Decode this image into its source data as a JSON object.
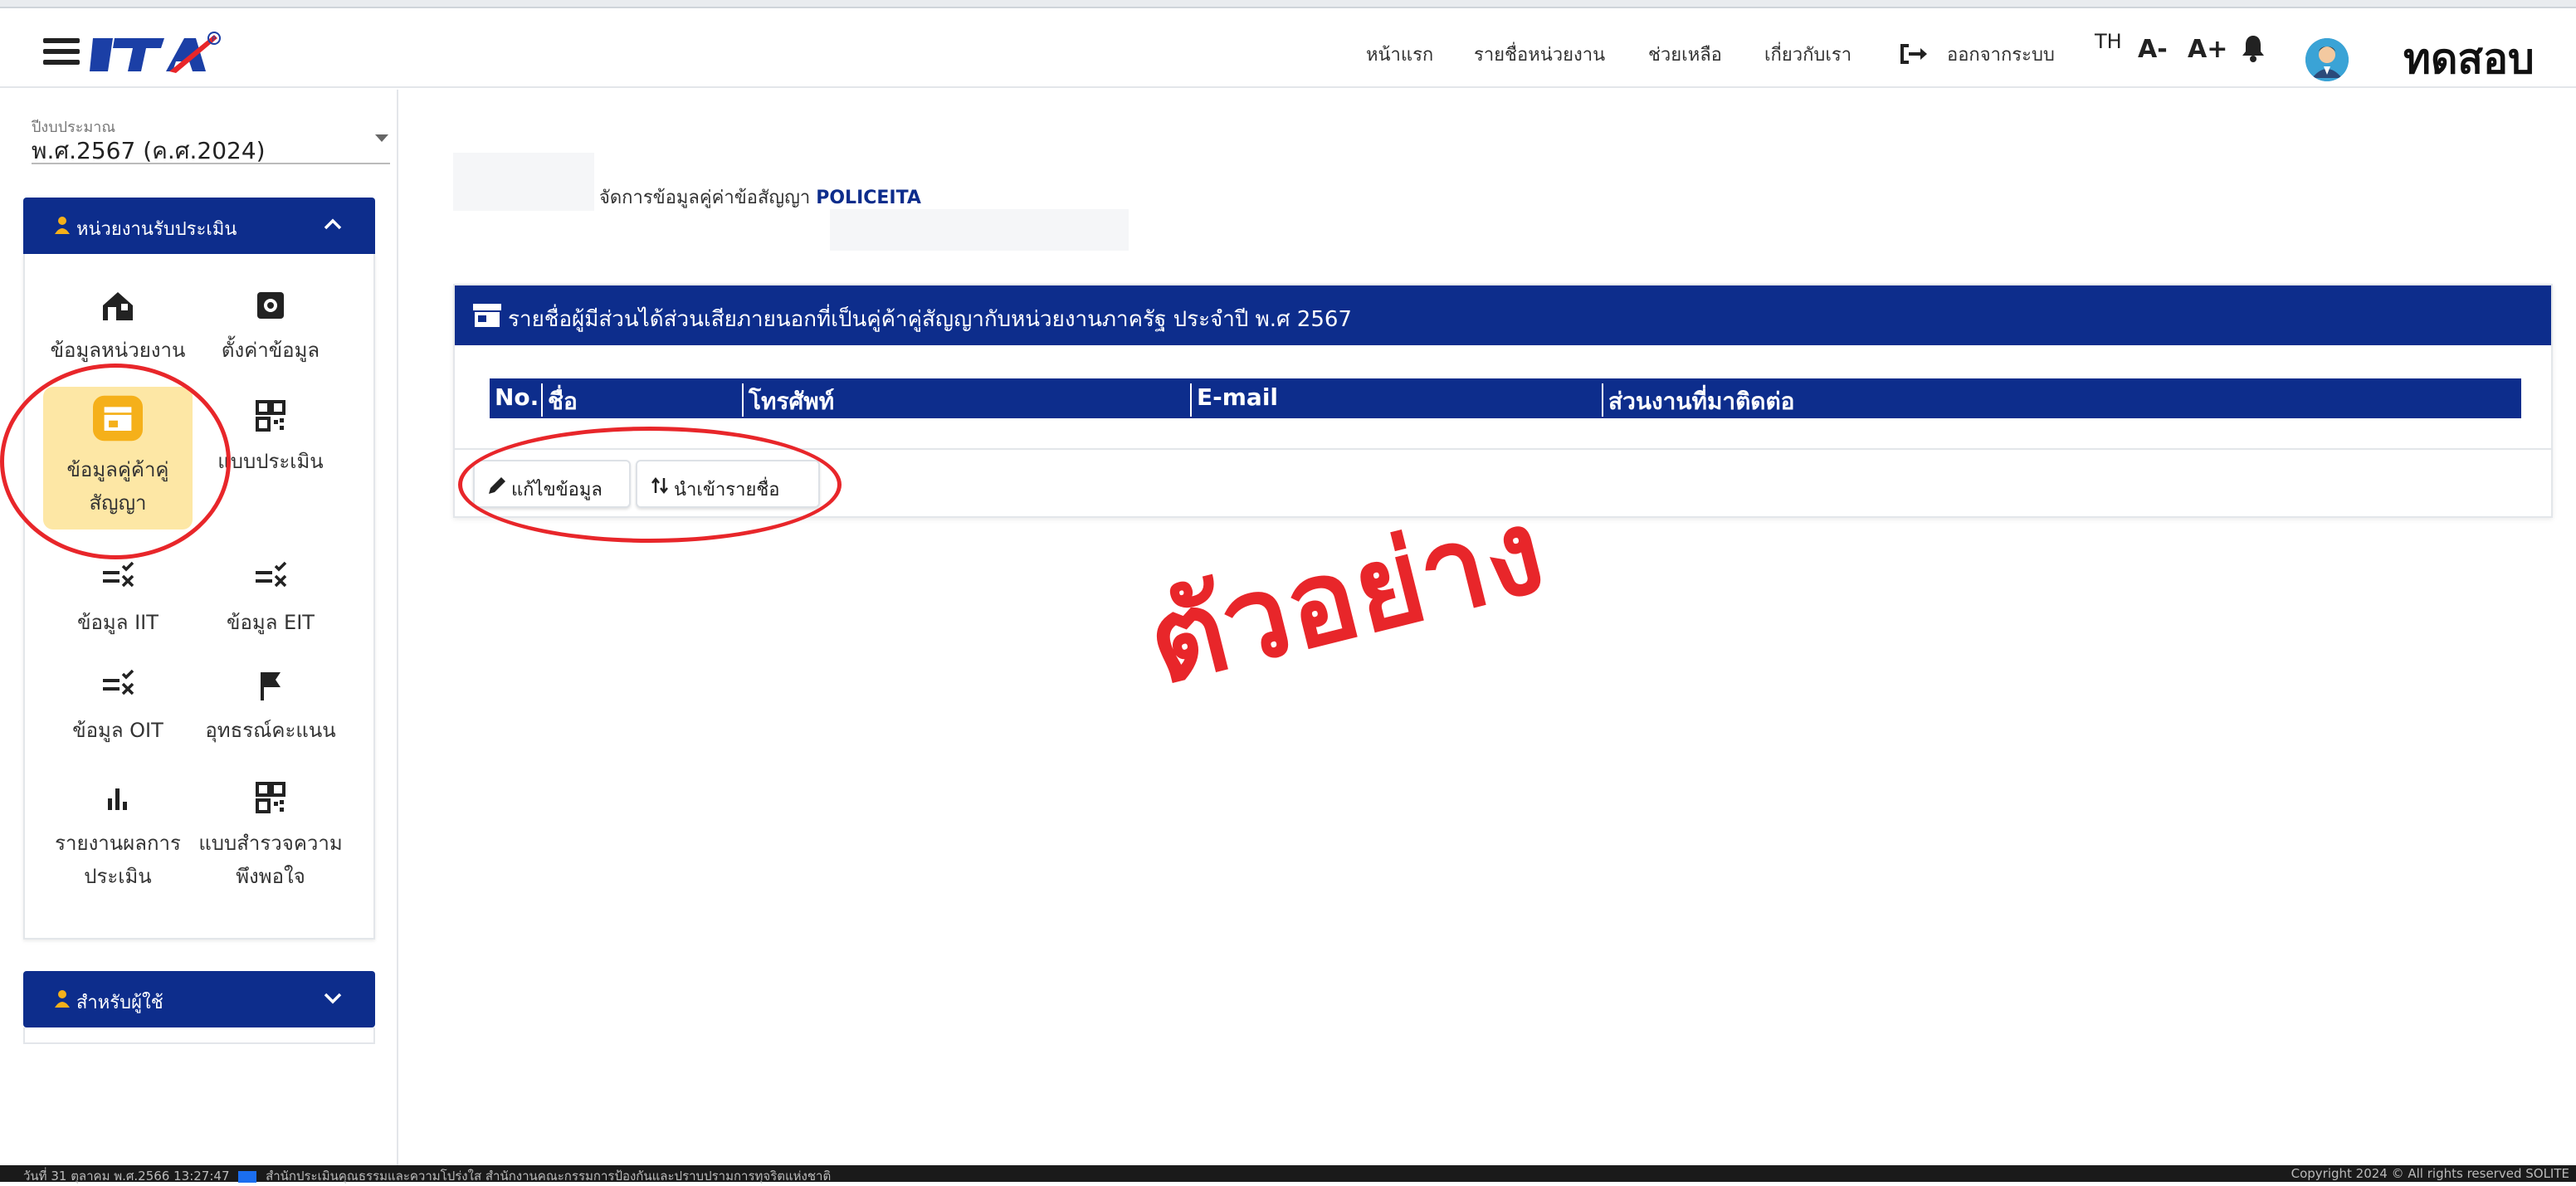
{
  "header": {
    "logo_text": "ITA",
    "nav": [
      "หน้าแรก",
      "รายชื่อหน่วยงาน",
      "ช่วยเหลือ",
      "เกี่ยวกับเรา"
    ],
    "logout_label": "ออกจากระบบ",
    "lang": "TH",
    "font_decrease": "A-",
    "font_increase": "A+",
    "username": "ทดสอบ"
  },
  "sidebar": {
    "year_label": "ปีงบประมาณ",
    "year_value": "พ.ศ.2567 (ค.ศ.2024)",
    "panel_assessed": "หน่วยงานรับประเมิน",
    "tiles": [
      {
        "label_1": "ข้อมูลหน่วยงาน",
        "label_2": "",
        "icon": "home-icon"
      },
      {
        "label_1": "ตั้งค่าข้อมูล",
        "label_2": "",
        "icon": "settings-icon"
      },
      {
        "label_1": "ข้อมูลคู่ค้าคู่",
        "label_2": "สัญญา",
        "icon": "store-icon"
      },
      {
        "label_1": "แบบประเมิน",
        "label_2": "",
        "icon": "qr-icon"
      },
      {
        "label_1": "ข้อมูล IIT",
        "label_2": "",
        "icon": "checklist-icon"
      },
      {
        "label_1": "ข้อมูล EIT",
        "label_2": "",
        "icon": "checklist-icon"
      },
      {
        "label_1": "ข้อมูล OIT",
        "label_2": "",
        "icon": "checklist-icon"
      },
      {
        "label_1": "อุทธรณ์คะแนน",
        "label_2": "",
        "icon": "flag-icon"
      },
      {
        "label_1": "รายงานผลการ",
        "label_2": "ประเมิน",
        "icon": "bar-chart-icon"
      },
      {
        "label_1": "แบบสำรวจความ",
        "label_2": "พึงพอใจ",
        "icon": "qr-icon"
      }
    ],
    "panel_user": "สำหรับผู้ใช้"
  },
  "main": {
    "breadcrumb_prefix": "จัดการข้อมูลคู่ค่าข้อสัญญา",
    "breadcrumb_org": "POLICEITA",
    "card_title": "รายชื่อผู้มีส่วนได้ส่วนเสียภายนอกที่เป็นคู่ค้าคู่สัญญากับหน่วยงานภาครัฐ ประจำปี พ.ศ 2567",
    "columns": [
      "No.",
      "ชื่อ",
      "โทรศัพท์",
      "E-mail",
      "ส่วนงานที่มาติดต่อ"
    ],
    "edit_button": "แก้ไขข้อมูล",
    "import_button": "นำเข้ารายชื่อ"
  },
  "watermark": "ตัวอย่าง",
  "footer": {
    "left": "วันที่ 31 ตุลาคม พ.ศ.2566 13:27:47",
    "left_org": "สำนักประเมินคุณธรรมและความโปร่งใส สำนักงานคณะกรรมการป้องกันและปราบปรามการทุจริตแห่งชาติ",
    "right": "Copyright 2024 © All rights reserved   SOLITE"
  },
  "colors": {
    "primary": "#0d2d8c",
    "highlight": "#fde7a5",
    "tile_icon": "#f5b01a",
    "annotation": "#e8262a"
  }
}
